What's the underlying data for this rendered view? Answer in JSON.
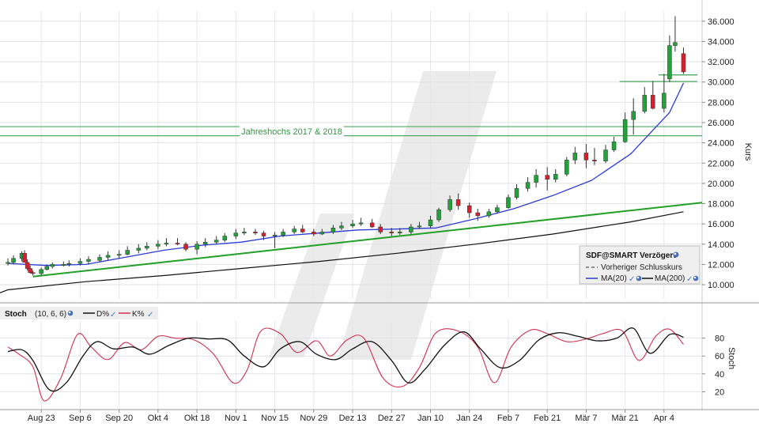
{
  "chart_data": [
    {
      "type": "candlestick",
      "ylabel": "Kurs",
      "ylim": [
        8.6,
        37.0
      ],
      "y_ticks": [
        "10.000",
        "12.000",
        "14.000",
        "16.000",
        "18.000",
        "20.000",
        "22.000",
        "24.000",
        "26.000",
        "28.000",
        "30.000",
        "32.000",
        "34.000",
        "36.000"
      ],
      "y_tick_values": [
        10,
        12,
        14,
        16,
        18,
        20,
        22,
        24,
        26,
        28,
        30,
        32,
        34,
        36
      ],
      "x_ticks": [
        "Aug 23",
        "Sep 6",
        "Sep 20",
        "Okt 4",
        "Okt 18",
        "Nov 1",
        "Nov 15",
        "Nov 29",
        "Dez 13",
        "Dez 27",
        "Jan 10",
        "Jan 24",
        "Feb 7",
        "Feb 21",
        "Mär 7",
        "Mär 21",
        "Apr 4"
      ],
      "x_range": [
        "2021-08-11",
        "2022-04-12"
      ],
      "grid": true,
      "candle_colors": {
        "up": "#22a33a",
        "down": "#d8202c"
      },
      "legend": {
        "title": "SDF@SMART Verzögert",
        "entries": [
          {
            "label": "Vorheriger Schlusskurs",
            "style": "dashed",
            "color": "#555555"
          },
          {
            "label": "MA(20)",
            "color": "#2a3bd6"
          },
          {
            "label": "MA(200)",
            "color": "#111111"
          }
        ],
        "placement": "bottom-right"
      },
      "annotation": {
        "text": "Jahreshochs 2017 & 2018",
        "levels": [
          25.6,
          24.7
        ],
        "color": "#3aa050"
      },
      "resistance_lines": [
        {
          "value": 30.05,
          "from": "2022-03-19",
          "to": "2022-04-12"
        },
        {
          "value": 30.7,
          "from": "2022-04-02",
          "to": "2022-04-12"
        }
      ],
      "trendline": {
        "from": {
          "x": "2021-08-20",
          "y": 10.8
        },
        "to": {
          "x": "2022-04-12",
          "y": 18.1
        },
        "color": "#22a028"
      },
      "series": [
        {
          "name": "SDF",
          "kind": "ohlc",
          "dates": [
            "2021-08-11",
            "2021-08-13",
            "2021-08-16",
            "2021-08-17",
            "2021-08-18",
            "2021-08-19",
            "2021-08-20",
            "2021-08-23",
            "2021-08-25",
            "2021-08-27",
            "2021-08-31",
            "2021-09-02",
            "2021-09-06",
            "2021-09-09",
            "2021-09-13",
            "2021-09-16",
            "2021-09-20",
            "2021-09-23",
            "2021-09-27",
            "2021-09-30",
            "2021-10-04",
            "2021-10-07",
            "2021-10-11",
            "2021-10-14",
            "2021-10-18",
            "2021-10-21",
            "2021-10-25",
            "2021-10-28",
            "2021-11-01",
            "2021-11-04",
            "2021-11-08",
            "2021-11-11",
            "2021-11-15",
            "2021-11-18",
            "2021-11-22",
            "2021-11-25",
            "2021-11-29",
            "2021-12-02",
            "2021-12-06",
            "2021-12-09",
            "2021-12-13",
            "2021-12-16",
            "2021-12-20",
            "2021-12-23",
            "2021-12-27",
            "2021-12-30",
            "2022-01-03",
            "2022-01-06",
            "2022-01-10",
            "2022-01-13",
            "2022-01-17",
            "2022-01-20",
            "2022-01-24",
            "2022-01-27",
            "2022-01-31",
            "2022-02-03",
            "2022-02-07",
            "2022-02-10",
            "2022-02-14",
            "2022-02-17",
            "2022-02-21",
            "2022-02-24",
            "2022-02-28",
            "2022-03-03",
            "2022-03-07",
            "2022-03-10",
            "2022-03-14",
            "2022-03-17",
            "2022-03-21",
            "2022-03-24",
            "2022-03-28",
            "2022-03-31",
            "2022-04-04",
            "2022-04-06",
            "2022-04-08",
            "2022-04-11"
          ],
          "open": [
            12.1,
            12.2,
            12.6,
            13.1,
            12.2,
            11.6,
            11.2,
            11.1,
            11.5,
            11.8,
            12.0,
            12.0,
            12.1,
            12.3,
            12.4,
            12.7,
            12.9,
            13.0,
            13.4,
            13.6,
            13.8,
            14.0,
            14.1,
            14.0,
            13.5,
            14.0,
            14.2,
            14.4,
            14.8,
            15.1,
            15.2,
            15.1,
            14.8,
            14.9,
            15.2,
            15.5,
            15.2,
            15.0,
            15.2,
            15.6,
            15.8,
            16.0,
            16.1,
            15.7,
            15.2,
            15.1,
            15.2,
            15.7,
            15.8,
            16.4,
            17.4,
            18.4,
            17.8,
            17.1,
            16.8,
            17.2,
            17.6,
            18.6,
            19.5,
            20.1,
            20.8,
            20.4,
            20.9,
            22.3,
            23.0,
            22.3,
            22.2,
            23.3,
            24.1,
            26.3,
            27.1,
            28.7,
            27.4,
            30.3,
            33.6,
            32.8
          ],
          "high": [
            12.6,
            12.9,
            13.3,
            13.4,
            12.5,
            11.9,
            11.4,
            11.7,
            12.0,
            12.2,
            12.3,
            12.4,
            12.6,
            12.8,
            13.0,
            13.3,
            13.4,
            13.8,
            14.0,
            14.2,
            14.4,
            14.6,
            14.6,
            14.2,
            14.3,
            14.6,
            14.8,
            15.1,
            15.5,
            15.6,
            15.5,
            15.3,
            15.2,
            15.5,
            15.8,
            15.9,
            15.5,
            15.5,
            15.9,
            16.2,
            16.4,
            16.6,
            16.5,
            16.0,
            15.6,
            15.6,
            16.0,
            16.2,
            16.8,
            17.6,
            18.8,
            19.0,
            18.1,
            17.5,
            17.5,
            17.9,
            18.9,
            19.9,
            20.6,
            21.4,
            21.6,
            21.4,
            22.6,
            23.6,
            23.9,
            23.5,
            23.8,
            24.6,
            27.0,
            28.4,
            29.5,
            30.1,
            30.8,
            34.6,
            36.5,
            33.4
          ],
          "low": [
            11.9,
            12.0,
            12.3,
            12.3,
            11.4,
            11.1,
            10.9,
            10.9,
            11.4,
            11.6,
            11.8,
            11.8,
            11.9,
            12.0,
            12.2,
            12.4,
            12.6,
            12.9,
            13.1,
            13.4,
            13.5,
            13.8,
            13.9,
            13.3,
            13.0,
            13.7,
            14.0,
            14.2,
            14.5,
            14.9,
            14.9,
            14.4,
            13.6,
            14.7,
            15.0,
            15.1,
            14.8,
            14.9,
            15.0,
            15.4,
            15.6,
            15.8,
            15.6,
            15.0,
            14.8,
            14.9,
            15.0,
            15.5,
            15.6,
            16.2,
            17.2,
            17.4,
            16.6,
            16.3,
            16.6,
            17.0,
            17.5,
            18.4,
            19.2,
            19.6,
            19.3,
            20.1,
            20.7,
            21.9,
            21.5,
            21.8,
            22.0,
            23.1,
            24.0,
            24.8,
            26.9,
            27.3,
            27.0,
            30.0,
            33.0,
            30.8
          ],
          "close": [
            12.2,
            12.6,
            13.1,
            12.2,
            11.6,
            11.2,
            11.1,
            11.5,
            11.8,
            12.0,
            12.0,
            12.1,
            12.3,
            12.5,
            12.7,
            12.9,
            13.0,
            13.4,
            13.6,
            13.8,
            14.0,
            14.1,
            14.0,
            13.5,
            14.0,
            14.2,
            14.4,
            14.8,
            15.1,
            15.2,
            15.1,
            14.8,
            14.9,
            15.2,
            15.5,
            15.2,
            15.0,
            15.2,
            15.6,
            15.8,
            16.0,
            16.1,
            15.7,
            15.2,
            15.1,
            15.2,
            15.7,
            15.8,
            16.4,
            17.4,
            18.4,
            17.8,
            17.1,
            16.8,
            17.2,
            17.6,
            18.6,
            19.5,
            20.1,
            20.8,
            20.4,
            20.9,
            22.3,
            23.0,
            22.3,
            22.2,
            23.3,
            24.1,
            26.3,
            27.1,
            28.7,
            27.4,
            28.9,
            33.6,
            33.9,
            31.0
          ]
        },
        {
          "name": "MA(20)",
          "dates": [
            "2021-08-11",
            "2021-08-25",
            "2021-09-08",
            "2021-09-22",
            "2021-10-06",
            "2021-10-20",
            "2021-11-03",
            "2021-11-17",
            "2021-12-01",
            "2021-12-15",
            "2021-12-29",
            "2022-01-12",
            "2022-01-26",
            "2022-02-09",
            "2022-02-23",
            "2022-03-09",
            "2022-03-23",
            "2022-04-06",
            "2022-04-11"
          ],
          "values": [
            12.1,
            11.9,
            12.0,
            12.7,
            13.4,
            13.9,
            14.2,
            14.8,
            15.1,
            15.4,
            15.5,
            15.6,
            16.5,
            17.5,
            18.8,
            20.3,
            22.9,
            27.0,
            29.9
          ]
        },
        {
          "name": "MA(200)",
          "dates": [
            "2021-08-11",
            "2021-09-08",
            "2021-10-06",
            "2021-11-03",
            "2021-12-01",
            "2021-12-29",
            "2022-01-26",
            "2022-02-23",
            "2022-03-23",
            "2022-04-11"
          ],
          "values": [
            9.5,
            10.3,
            10.9,
            11.6,
            12.3,
            13.1,
            14.0,
            15.0,
            16.2,
            17.2
          ]
        }
      ]
    },
    {
      "type": "line",
      "title": "Stoch",
      "params": "(10, 6, 6)",
      "ylabel": "Stoch",
      "ylim": [
        0,
        100
      ],
      "y_ticks": [
        "20",
        "40",
        "60",
        "80"
      ],
      "y_tick_values": [
        20,
        40,
        60,
        80
      ],
      "grid": true,
      "series": [
        {
          "name": "D%",
          "color": "#111111",
          "dates": [
            "2021-08-11",
            "2021-08-16",
            "2021-08-20",
            "2021-08-26",
            "2021-09-01",
            "2021-09-07",
            "2021-09-12",
            "2021-09-18",
            "2021-09-25",
            "2021-10-01",
            "2021-10-08",
            "2021-10-15",
            "2021-10-22",
            "2021-10-29",
            "2021-11-04",
            "2021-11-11",
            "2021-11-17",
            "2021-11-24",
            "2021-11-30",
            "2021-12-07",
            "2021-12-13",
            "2021-12-20",
            "2021-12-27",
            "2022-01-02",
            "2022-01-08",
            "2022-01-15",
            "2022-01-22",
            "2022-01-28",
            "2022-02-04",
            "2022-02-11",
            "2022-02-18",
            "2022-02-25",
            "2022-03-04",
            "2022-03-11",
            "2022-03-18",
            "2022-03-24",
            "2022-03-30",
            "2022-04-06",
            "2022-04-11"
          ],
          "values": [
            65,
            67,
            55,
            22,
            30,
            60,
            76,
            68,
            70,
            62,
            72,
            80,
            79,
            78,
            60,
            48,
            68,
            76,
            62,
            56,
            68,
            76,
            55,
            30,
            45,
            72,
            87,
            68,
            47,
            55,
            78,
            86,
            82,
            77,
            80,
            91,
            63,
            84,
            81
          ]
        },
        {
          "name": "K%",
          "color": "#d03050",
          "dates": [
            "2021-08-11",
            "2021-08-15",
            "2021-08-20",
            "2021-08-24",
            "2021-08-30",
            "2021-09-05",
            "2021-09-10",
            "2021-09-16",
            "2021-09-22",
            "2021-09-28",
            "2021-10-04",
            "2021-10-10",
            "2021-10-17",
            "2021-10-24",
            "2021-10-31",
            "2021-11-05",
            "2021-11-10",
            "2021-11-17",
            "2021-11-23",
            "2021-11-30",
            "2021-12-05",
            "2021-12-11",
            "2021-12-17",
            "2021-12-24",
            "2021-12-31",
            "2022-01-06",
            "2022-01-12",
            "2022-01-20",
            "2022-01-27",
            "2022-02-02",
            "2022-02-08",
            "2022-02-15",
            "2022-02-21",
            "2022-02-28",
            "2022-03-07",
            "2022-03-13",
            "2022-03-20",
            "2022-03-26",
            "2022-04-01",
            "2022-04-06",
            "2022-04-11"
          ],
          "values": [
            70,
            62,
            48,
            10,
            35,
            84,
            70,
            56,
            75,
            67,
            82,
            80,
            78,
            62,
            30,
            44,
            88,
            85,
            64,
            77,
            60,
            78,
            80,
            35,
            26,
            47,
            86,
            88,
            70,
            30,
            70,
            89,
            85,
            76,
            79,
            85,
            88,
            55,
            82,
            90,
            73
          ]
        }
      ]
    }
  ]
}
